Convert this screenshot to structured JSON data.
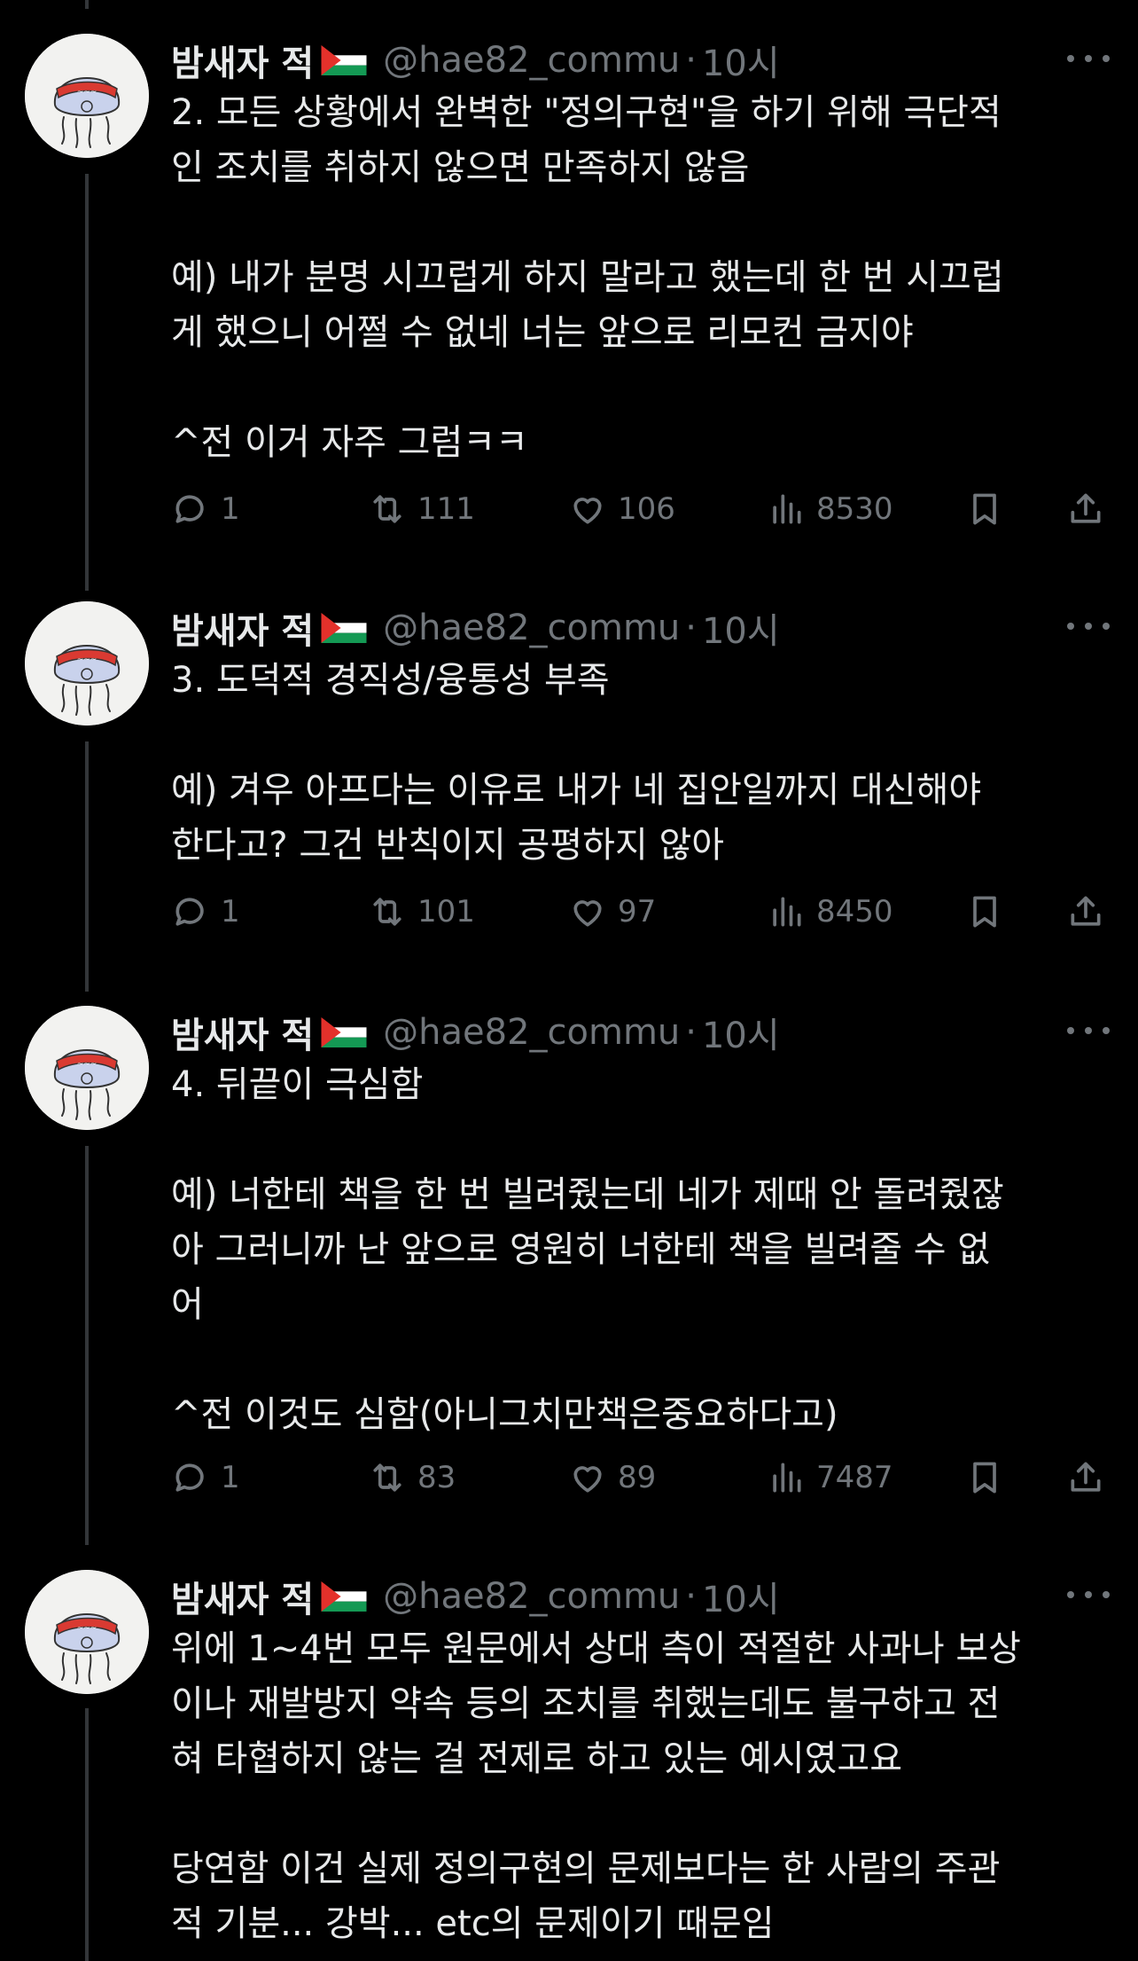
{
  "tweets": [
    {
      "name": "밤새자 적",
      "handle": "@hae82_commu",
      "dot": "·",
      "time": "10시",
      "text": "2. 모든 상황에서 완벽한 \"정의구현\"을 하기 위해 극단적\n인 조치를 취하지 않으면 만족하지 않음\n\n예) 내가 분명 시끄럽게 하지 말라고 했는데 한 번 시끄럽\n게 했으니 어쩔 수 없네 너는 앞으로 리모컨 금지야\n\n^전 이거 자주 그럼ㅋㅋ",
      "stats": {
        "replies": "1",
        "retweets": "111",
        "likes": "106",
        "views": "8530"
      }
    },
    {
      "name": "밤새자 적",
      "handle": "@hae82_commu",
      "dot": "·",
      "time": "10시",
      "text": "3. 도덕적 경직성/융통성 부족\n\n예) 겨우 아프다는 이유로 내가 네 집안일까지 대신해야\n한다고? 그건 반칙이지 공평하지 않아",
      "stats": {
        "replies": "1",
        "retweets": "101",
        "likes": "97",
        "views": "8450"
      }
    },
    {
      "name": "밤새자 적",
      "handle": "@hae82_commu",
      "dot": "·",
      "time": "10시",
      "text": "4. 뒤끝이 극심함\n\n예) 너한테 책을 한 번 빌려줬는데 네가 제때 안 돌려줬잖\n아 그러니까 난 앞으로 영원히 너한테 책을 빌려줄 수 없\n어\n\n^전 이것도 심함(아니그치만책은중요하다고)",
      "stats": {
        "replies": "1",
        "retweets": "83",
        "likes": "89",
        "views": "7487"
      }
    },
    {
      "name": "밤새자 적",
      "handle": "@hae82_commu",
      "dot": "·",
      "time": "10시",
      "text": "위에 1~4번 모두 원문에서 상대 측이 적절한 사과나 보상\n이나 재발방지 약속 등의 조치를 취했는데도 불구하고 전\n혀 타협하지 않는 걸 전제로 하고 있는 예시였고요\n\n당연함 이건 실제 정의구현의 문제보다는 한 사람의 주관\n적 기분... 강박... etc의 문제이기 때문임"
    }
  ],
  "icons": {
    "reply": "reply-icon",
    "retweet": "retweet-icon",
    "like": "heart-icon",
    "views": "views-icon",
    "bookmark": "bookmark-icon",
    "share": "share-icon",
    "more": "more-icon",
    "flag": "palestine-flag-icon"
  },
  "colors": {
    "background": "#000000",
    "text": "#e7e9ea",
    "muted": "#71767b",
    "line": "#333639"
  }
}
